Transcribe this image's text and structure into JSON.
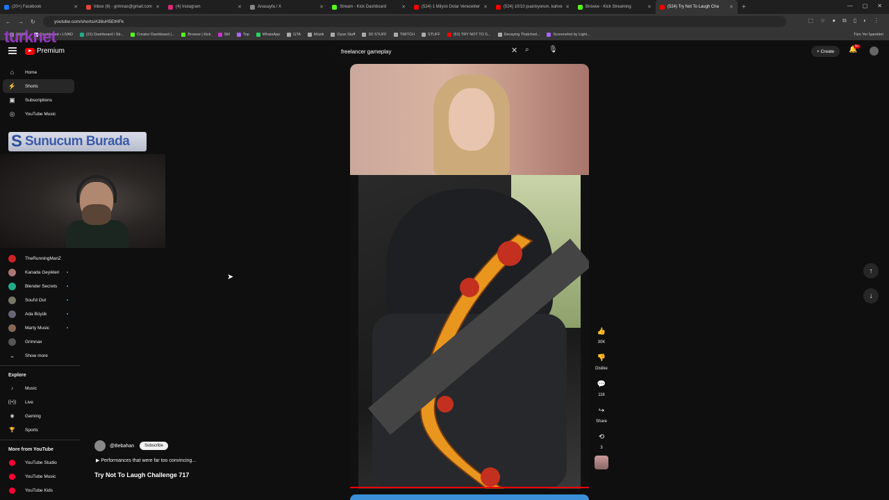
{
  "browser": {
    "tabs": [
      {
        "label": "(20+) Facebook",
        "color": "#1877f2"
      },
      {
        "label": "Inbox (6) - grimnas@gmail.com",
        "color": "#ea4335"
      },
      {
        "label": "(4) Instagram",
        "color": "#d62976"
      },
      {
        "label": "Anasayfa / X",
        "color": "#888888"
      },
      {
        "label": "Stream - Kick Dashboard",
        "color": "#53fc18"
      },
      {
        "label": "(524) 1 Milyon Dolar Verecekler",
        "color": "#ff0000"
      },
      {
        "label": "(524) 10/10 puanlıyorum, kahve",
        "color": "#ff0000"
      },
      {
        "label": "Browse - Kick Streaming",
        "color": "#53fc18"
      },
      {
        "label": "(524) Try Not To Laugh Cha",
        "color": "#ff0000",
        "active": true
      }
    ],
    "url": "youtube.com/shorts/A38uH5EtHFk",
    "bookmarks": [
      "GEAR",
      "Dashboard • LIVAD",
      "(21) Dashboard / Str...",
      "Creator Dashboard |...",
      "Browse | Kick",
      "SM",
      "Top",
      "WhatsApp",
      "GTA",
      "Müzik",
      "Oyun Stuff",
      "3D STUFF",
      "TWITCH",
      "STUFF",
      "(91) TRY NOT TO S...",
      "Decaying Thatched...",
      "Screenshot by Light..."
    ],
    "bookmarks_right": "Tüm Yer İşaretleri"
  },
  "overlay": {
    "brand": "turknet",
    "banner": "Sunucum Burada",
    "banner_s": "S"
  },
  "header": {
    "logo_text": "Premium",
    "search_value": "freelancer gameplay",
    "create_label": "Create",
    "notif_badge": "9+"
  },
  "sidebar": {
    "main": [
      {
        "label": "Home",
        "icon": "⌂"
      },
      {
        "label": "Shorts",
        "icon": "⚡"
      },
      {
        "label": "Subscriptions",
        "icon": "▣"
      },
      {
        "label": "YouTube Music",
        "icon": "◎"
      }
    ],
    "subs": [
      {
        "label": "TheRunningManZ",
        "color": "#c22"
      },
      {
        "label": "Kanada Geyikleri",
        "color": "#a77"
      },
      {
        "label": "Blender Secrets",
        "color": "#2a8"
      },
      {
        "label": "Soul'd Out",
        "color": "#776"
      },
      {
        "label": "Ada Büyük",
        "color": "#667"
      },
      {
        "label": "Marty Music",
        "color": "#865"
      },
      {
        "label": "Grimnax",
        "color": "#555"
      }
    ],
    "show_more": "Show more",
    "explore_title": "Explore",
    "explore": [
      {
        "label": "Music",
        "icon": "♪"
      },
      {
        "label": "Live",
        "icon": "((•))"
      },
      {
        "label": "Gaming",
        "icon": "◉"
      },
      {
        "label": "Sports",
        "icon": "🏆"
      }
    ],
    "more_title": "More from YouTube",
    "more": [
      {
        "label": "YouTube Studio"
      },
      {
        "label": "YouTube Music"
      },
      {
        "label": "YouTube Kids"
      }
    ]
  },
  "short": {
    "channel": "@Bebahan",
    "subscribe": "Subscribe",
    "description": "▶ Performances that were far too convincing...",
    "title": "Try Not To Laugh Challenge 717",
    "like_count": "30K",
    "dislike_label": "Dislike",
    "comment_count": "116",
    "share_label": "Share",
    "remix_count": "3"
  }
}
